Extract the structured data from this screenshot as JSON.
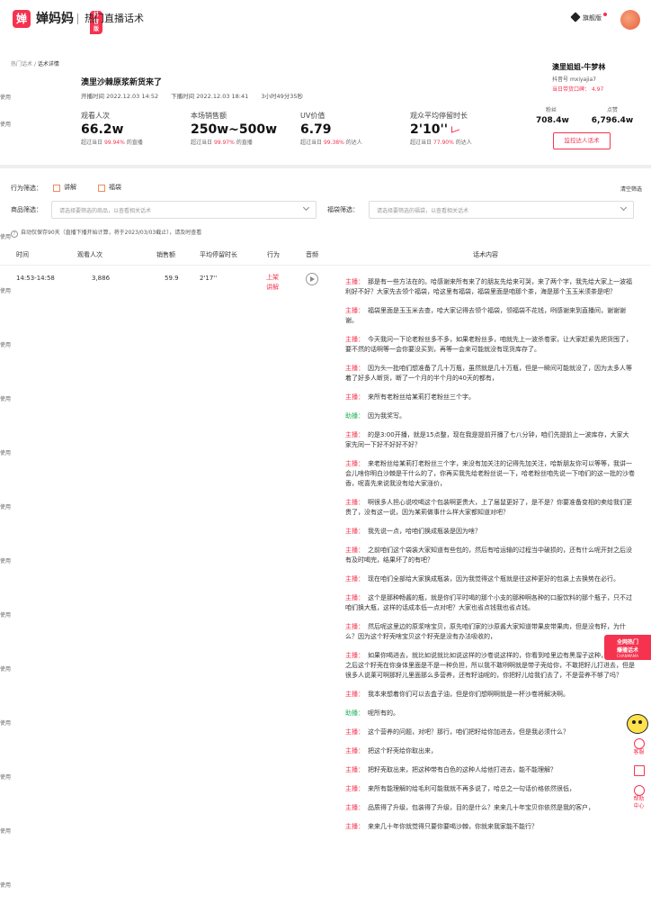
{
  "header": {
    "logo_glyph": "婵",
    "brand": "婵妈妈",
    "badge": "抖音版",
    "subtitle": "热门直播话术",
    "vip_label": "旗舰版"
  },
  "left_edge_text": "使用",
  "breadcrumb": {
    "parent": "热门话术",
    "separator": "/",
    "current": "话术详情"
  },
  "live": {
    "title": "澳里沙棘原浆新货来了",
    "start_label": "开播时间",
    "start": "2022.12.03 14:52",
    "end_label": "下播时间",
    "end": "2022.12.03 18:41",
    "duration": "3小时49分35秒"
  },
  "metrics": [
    {
      "label": "观看人次",
      "value": "66.2w",
      "prefix": "超过当日",
      "pct": "99.94%",
      "suffix": "的直播"
    },
    {
      "label": "本场销售额",
      "value": "250w~500w",
      "prefix": "超过当日",
      "pct": "99.97%",
      "suffix": "的直播"
    },
    {
      "label": "UV价值",
      "value": "6.79",
      "prefix": "超过当日",
      "pct": "99.38%",
      "suffix": "的达人"
    },
    {
      "label": "观众平均停留时长",
      "value": "2'10''",
      "prefix": "超过当日",
      "pct": "77.90%",
      "suffix": "的达人"
    }
  ],
  "streamer": {
    "name": "澳里姐姐-牛梦林",
    "account_label": "抖音号",
    "account": "mxiyajia7",
    "rank_label": "当日带货口碑：",
    "rank_value": "4.97",
    "fans_label": "粉丝",
    "fans": "708.4w",
    "likes_label": "点赞",
    "likes": "6,796.4w",
    "monitor_button": "监控达人话术"
  },
  "filters": {
    "behavior_label": "行为筛选：",
    "behavior_options": [
      "讲解",
      "福袋"
    ],
    "clear": "清空筛选",
    "product_label": "商品筛选：",
    "product_placeholder": "请选择要筛选的商品，以查看相关话术",
    "bag_label": "福袋筛选：",
    "bag_placeholder": "请选择要筛选的福袋，以查看相关话术",
    "notice": "自动仅保存90天（直播下播开始计算，将于2023/03/03截止），请及时查看"
  },
  "table": {
    "columns": [
      "时间",
      "观看人次",
      "销售额",
      "平均停留时长",
      "行为",
      "音频",
      "话术内容"
    ],
    "row": {
      "time": "14:53-14:58",
      "views": "3,886",
      "sales": "59.9",
      "avg_stay": "2'17''",
      "actions": [
        "上架",
        "讲解"
      ]
    }
  },
  "speakers": {
    "host": "主播：",
    "assistant": "助播："
  },
  "script_lines": [
    {
      "role": "host",
      "text": "那是有一些方法在的。哈感谢来所有来了的朋友先给来可哭，来了两个字，我先给大家上一波福利好不好？大家先去领个福袋，哈这里有福袋，福袋里面是咱那个茶，海是那个玉玉米须茶是吧？"
    },
    {
      "role": "host",
      "text": "福袋里面是玉玉米去查，哈大家记得去领个福袋，领福袋不花钱，咧感谢来到直播间，谢谢谢谢。"
    },
    {
      "role": "host",
      "text": "今天我问一下论老粉丝多不多，如果老粉丝多，咱就先上一波杀卷家，让大家赶紧先把货囤了，要不然的话啊等一会你要没买到，再等一会来可能就没有现货库存了。"
    },
    {
      "role": "host",
      "text": "因为头一批咱们想准备了几十万瓶，虽然就是几十万瓶，但是一瞬间可能就没了，因为太多人等着了好多人断货，断了一个月的半个月的40天的都有，"
    },
    {
      "role": "host",
      "text": "来所有老粉丝给某莉打老粉丝三个字。"
    },
    {
      "role": "asst",
      "text": "因为我奖写。"
    },
    {
      "role": "host",
      "text": "的是3:00开播，就是15点整，现在我是提前开播了七八分钟，咱们先提前上一波库存，大家大家先同一下好不好好不好？"
    },
    {
      "role": "host",
      "text": "来老粉丝给某莉打老粉丝三个字，来没有加关注的记得先加关注，哈新朋友你可以等等，我讲一会儿啥你明白沙棘是干什么的了，你再买我先给老粉丝说一下，哈老粉丝咱先说一下咱们的这一批的沙卷香，呢喜先来说我没有给大家涨价，"
    },
    {
      "role": "host",
      "text": "啊很多人担心说咬喝这个包装啊更贵大，上了届鼠更好了，是不是？你要准备变相的卖给我们更贵了，没有这一说，因为某莉做事什么样大家都知道对吧？"
    },
    {
      "role": "host",
      "text": "我先说一点，哈咱们换成瓶装是因为啥？"
    },
    {
      "role": "host",
      "text": "之前咱们这个袋装大家知道有些包的，然后有哈运输的过程当中破损的，还有什么呢开封之后没有及时喝完，结果坏了的有吧？"
    },
    {
      "role": "host",
      "text": "现在咱们全部给大家换成瓶装，因为我觉得这个瓶就是往这种更好的包装上去换势在必行。"
    },
    {
      "role": "host",
      "text": "这个是那种畅酱的瓶，就是你们平时喝的那个小支的那种啊各种的口服饮料的那个瓶子，只不过咱们换大瓶，这样的话成本低一点对吧？大家也省点钱我也省点钱。"
    },
    {
      "role": "host",
      "text": "然后呢这里边的原浆啥宝贝，原先咱们家的沙原酱大家知道带果皮带果肉，但是没有籽，为什么？因为这个籽壳啥宝贝这个籽壳是没有办法吸收的，"
    },
    {
      "role": "host",
      "text": "如果你喝进去，就比如说就比如说这样的沙卷说这样的，你看到哈里边有黑溜子这种，你喝进去之后这个籽壳在你身体里面是不是一种负担，所以我不敢咧啊就是带子壳给你，不敢把籽儿打进去，但是很多人说莱可啊那籽儿里面那么多营养，还有籽油呢的，你把籽儿给我们去了，不是营养不够了吗？"
    },
    {
      "role": "host",
      "text": "我本来想着你们可以去盒子油，但是你们想啊啊就是一杯沙卷将解决啊。"
    },
    {
      "role": "asst",
      "text": "呢所有的。"
    },
    {
      "role": "host",
      "text": "这个营养的问题，对吧？那行，咱们把籽给你加进去，但是我必须什么？"
    },
    {
      "role": "host",
      "text": "把这个籽壳给你取出来，"
    },
    {
      "role": "host",
      "text": "把籽壳取出来，把这种带有白色的这种人给他打进去，能不能理解？"
    },
    {
      "role": "host",
      "text": "来所有能理解的给毛利可能我就不再多说了，哈总之一句话价格依然很低，"
    },
    {
      "role": "host",
      "text": "品质得了升级，包装得了升级，目的是什么？来来几十年宝贝你依然是我的客户，"
    },
    {
      "role": "host",
      "text": "来来几十年你就觉得只要你要喝沙棘，你就来我家能不能行？"
    }
  ],
  "promo": {
    "line1": "全网热门",
    "line2": "爆播话术",
    "line3": "CHANMAMA"
  },
  "side_tools": [
    {
      "icon": "headset-icon",
      "label": "客服"
    },
    {
      "icon": "qr-code-icon",
      "label": ""
    },
    {
      "icon": "help-icon",
      "label": "帮助中心"
    }
  ],
  "colors": {
    "accent": "#f5334f",
    "assistant": "#21b15c",
    "checkbox": "#f08a5d"
  }
}
